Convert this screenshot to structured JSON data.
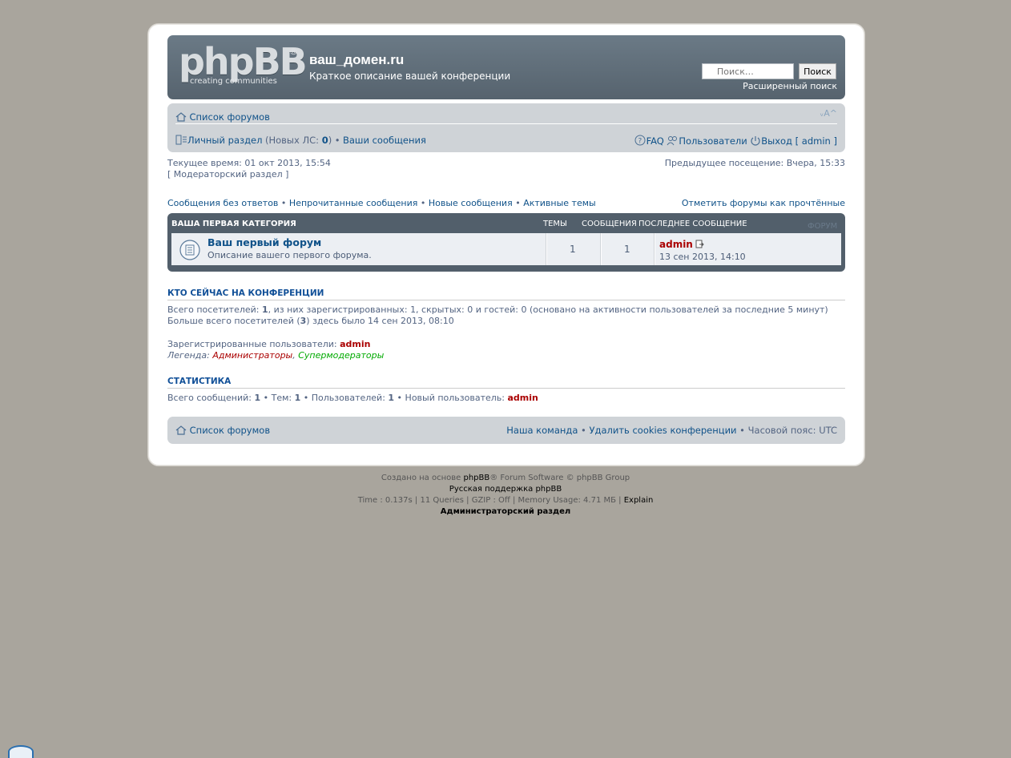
{
  "header": {
    "logo_main": "phpBB",
    "logo_reg": "®",
    "logo_sub": "creating   communities",
    "site_title": "ваш_домен.ru",
    "site_desc": "Краткое описание вашей конференции",
    "search_placeholder": "Поиск…",
    "search_button": "Поиск",
    "advanced_search": "Расширенный поиск"
  },
  "navbar": {
    "forum_index": "Список форумов",
    "font_size": "ᵥA^",
    "ucp": "Личный раздел",
    "pm_prefix": "(Новых ЛС: ",
    "pm_count": "0",
    "pm_suffix": ")",
    "sep": "•",
    "your_posts": "Ваши сообщения",
    "faq": "FAQ",
    "members": "Пользователи",
    "logout": "Выход [ admin ]"
  },
  "timeinfo": {
    "current_time": "Текущее время: 01 окт 2013, 15:54",
    "mcp": "[ Модераторский раздел ]",
    "last_visit": "Предыдущее посещение: Вчера, 15:33"
  },
  "quick_links": {
    "unanswered": "Сообщения без ответов",
    "unread": "Непрочитанные сообщения",
    "new_posts": "Новые сообщения",
    "active": "Активные темы",
    "mark_read": "Отметить форумы как прочтённые",
    "sep": "•"
  },
  "forum_table": {
    "category": "Ваша первая категория",
    "col_topics": "Темы",
    "col_posts": "Сообщения",
    "col_last": "Последнее сообщение",
    "ghost_label": "Форум",
    "forum": {
      "title": "Ваш первый форум",
      "desc": "Описание вашего первого форума.",
      "topics": "1",
      "posts": "1",
      "last_user": "admin",
      "last_date": "13 сен 2013, 14:10"
    }
  },
  "online": {
    "title": "Кто сейчас на конференции",
    "line1_a": "Всего посетителей: ",
    "line1_total": "1",
    "line1_b": ", из них зарегистрированных: 1, скрытых: 0 и гостей: 0 (основано на активности пользователей за последние 5 минут)",
    "line2_a": "Больше всего посетителей (",
    "line2_max": "3",
    "line2_b": ") здесь было 14 сен 2013, 08:10",
    "registered_label": "Зарегистрированные пользователи: ",
    "registered_user": "admin",
    "legend_label": "Легенда: ",
    "legend_admins": "Администраторы",
    "legend_comma": ", ",
    "legend_smods": "Супермодераторы"
  },
  "stats": {
    "title": "Статистика",
    "posts_label": "Всего сообщений: ",
    "posts": "1",
    "topics_label": " • Тем: ",
    "topics": "1",
    "users_label": " • Пользователей: ",
    "users": "1",
    "newest_label": " • Новый пользователь: ",
    "newest": "admin"
  },
  "footer": {
    "forum_index": "Список форумов",
    "team": "Наша команда",
    "sep": " • ",
    "delete_cookies": "Удалить cookies конференции",
    "timezone": "Часовой пояс: UTC"
  },
  "copyright": {
    "line1_a": "Создано на основе ",
    "line1_link": "phpBB",
    "line1_b": "® Forum Software © phpBB Group",
    "line2": "Русская поддержка phpBB",
    "line3_a": "Time : 0.137s | 11 Queries | GZIP : Off | Memory Usage: 4.71 МБ | ",
    "line3_link": "Explain",
    "line4": "Администраторский раздел"
  },
  "colors": {
    "background": "#a9a59d",
    "header": "#5e6b76",
    "link": "#105289",
    "admin": "#aa0000",
    "supermod": "#00aa00"
  }
}
